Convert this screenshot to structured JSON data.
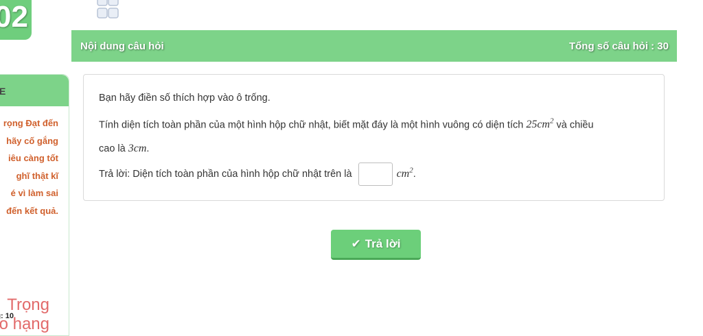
{
  "badge_number": "02",
  "header": {
    "left": "Nội dung câu hỏi",
    "right": "Tổng số câu hỏi : 30"
  },
  "sidebar": {
    "title_partial": "E",
    "text_lines": [
      "rọng Đạt đến",
      "hãy cố gắng",
      "iêu càng tốt",
      "ghĩ thật kĩ",
      "é vì làm sai",
      "đến kết quả."
    ],
    "big_lines": [
      "Trọng",
      "o hạng"
    ],
    "footer": "g: 10"
  },
  "question": {
    "instruction": "Bạn hãy điền số thích hợp vào ô trống.",
    "line2_text": "Tính diện tích toàn phần của một hình hộp chữ nhật, biết mặt đáy là một hình vuông có diện tích",
    "line2_math": "25cm",
    "line2_exp": "2",
    "line2_tail": "và chiều",
    "line3_text": "cao là",
    "line3_math": "3cm",
    "line3_end": ".",
    "answer_prefix": "Trả lời: Diện tích toàn phần của hình hộp chữ nhật trên là",
    "answer_value": "",
    "answer_unit": "cm",
    "answer_unit_exp": "2",
    "answer_end": "."
  },
  "submit": {
    "icon": "check-icon",
    "label": "Trả lời"
  },
  "colors": {
    "header_green": "#7dd389",
    "button_green": "#6ccf7a",
    "sidebar_text": "#d0602c",
    "sidebar_big": "#e26a6a"
  }
}
